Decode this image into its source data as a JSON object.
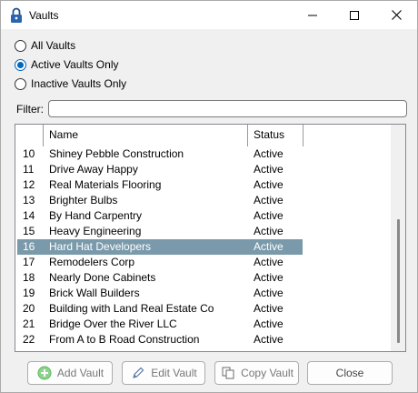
{
  "window": {
    "title": "Vaults"
  },
  "filter_options": [
    {
      "label": "All Vaults",
      "checked": false
    },
    {
      "label": "Active Vaults Only",
      "checked": true
    },
    {
      "label": "Inactive Vaults Only",
      "checked": false
    }
  ],
  "filter": {
    "label": "Filter:",
    "value": ""
  },
  "list": {
    "columns": [
      "Name",
      "Status"
    ],
    "rows": [
      {
        "num": "10",
        "name": "Shiney Pebble Construction",
        "status": "Active",
        "selected": false
      },
      {
        "num": "11",
        "name": "Drive Away Happy",
        "status": "Active",
        "selected": false
      },
      {
        "num": "12",
        "name": "Real Materials Flooring",
        "status": "Active",
        "selected": false
      },
      {
        "num": "13",
        "name": "Brighter Bulbs",
        "status": "Active",
        "selected": false
      },
      {
        "num": "14",
        "name": "By Hand Carpentry",
        "status": "Active",
        "selected": false
      },
      {
        "num": "15",
        "name": "Heavy Engineering",
        "status": "Active",
        "selected": false
      },
      {
        "num": "16",
        "name": "Hard Hat Developers",
        "status": "Active",
        "selected": true
      },
      {
        "num": "17",
        "name": "Remodelers Corp",
        "status": "Active",
        "selected": false
      },
      {
        "num": "18",
        "name": "Nearly Done Cabinets",
        "status": "Active",
        "selected": false
      },
      {
        "num": "19",
        "name": "Brick Wall Builders",
        "status": "Active",
        "selected": false
      },
      {
        "num": "20",
        "name": "Building with Land Real Estate Co",
        "status": "Active",
        "selected": false
      },
      {
        "num": "21",
        "name": "Bridge Over the River LLC",
        "status": "Active",
        "selected": false
      },
      {
        "num": "22",
        "name": "From A to B Road Construction",
        "status": "Active",
        "selected": false
      }
    ]
  },
  "buttons": {
    "add": "Add Vault",
    "edit": "Edit Vault",
    "copy": "Copy Vault",
    "close": "Close"
  },
  "colors": {
    "selection": "#7a9aab",
    "radio_accent": "#0067c0",
    "add_icon": "#5cb85c"
  }
}
